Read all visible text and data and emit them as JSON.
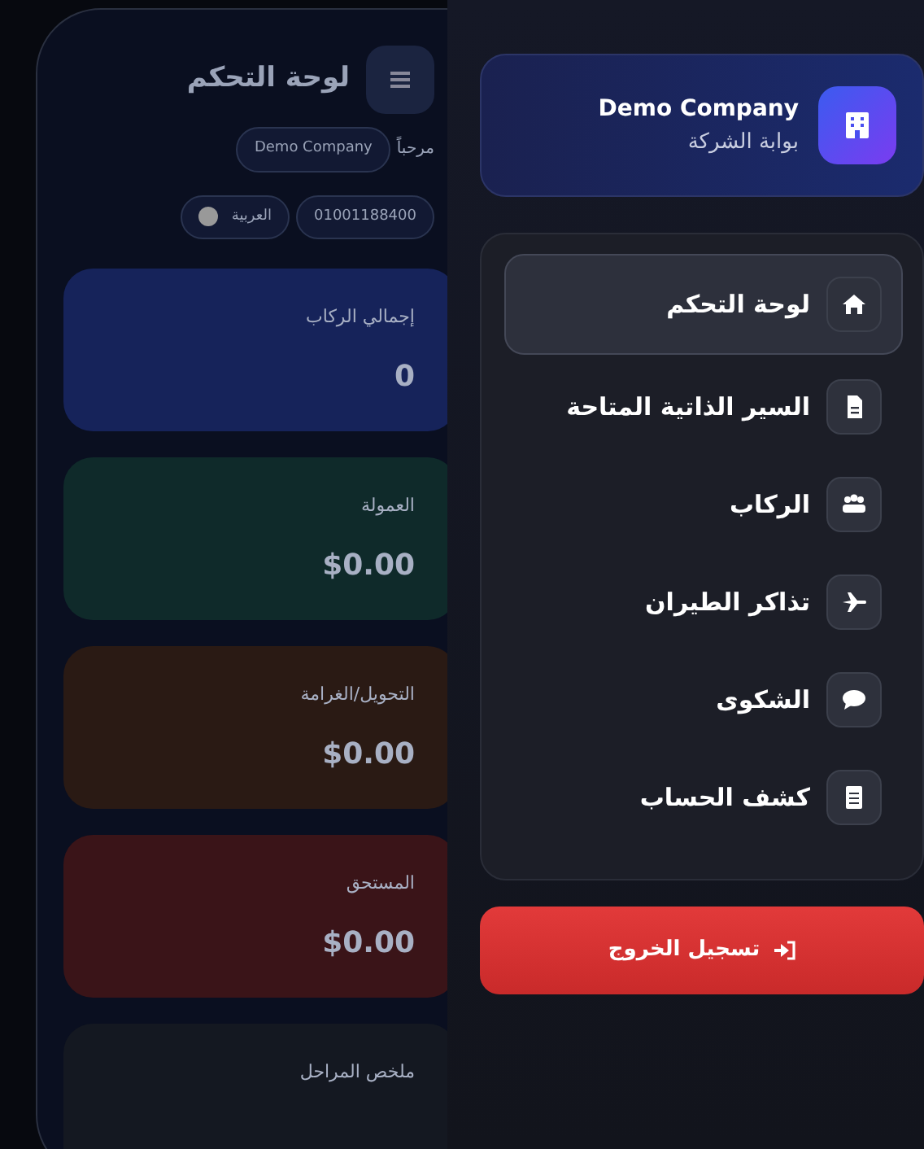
{
  "dashboard": {
    "title": "لوحة التحكم",
    "greeting": "مرحباً",
    "company": "Demo Company",
    "phone": "01001188400",
    "language": "العربية",
    "stats": [
      {
        "label": "إجمالي الركاب",
        "value": "0",
        "color": "#16235a"
      },
      {
        "label": "العمولة",
        "value": "$0.00",
        "color": "#0f2a2a"
      },
      {
        "label": "التحويل/الغرامة",
        "value": "$0.00",
        "color": "#2a1a14"
      },
      {
        "label": "المستحق",
        "value": "$0.00",
        "color": "#3a1418"
      },
      {
        "label": "ملخص المراحل",
        "color": "#141821"
      }
    ]
  },
  "drawer": {
    "company": {
      "name": "Demo Company",
      "subtitle": "بوابة الشركة"
    },
    "nav": [
      {
        "label": "لوحة التحكم",
        "selected": true
      },
      {
        "label": "السير الذاتية المتاحة",
        "selected": false
      },
      {
        "label": "الركاب",
        "selected": false
      },
      {
        "label": "تذاكر الطيران",
        "selected": false
      },
      {
        "label": "الشكوى",
        "selected": false
      },
      {
        "label": "كشف الحساب",
        "selected": false
      }
    ],
    "logout": "تسجيل الخروج"
  }
}
